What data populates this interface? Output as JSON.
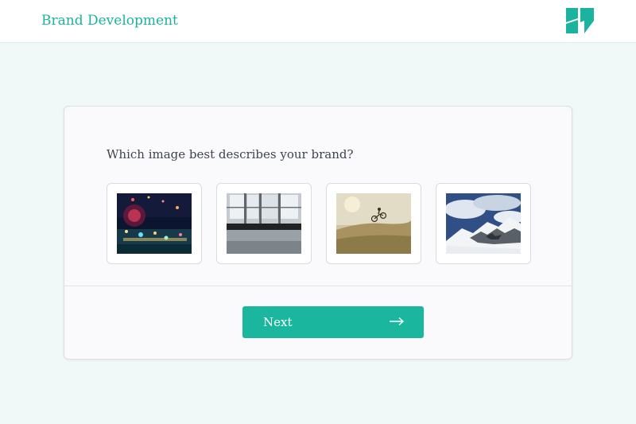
{
  "header": {
    "title": "Brand Development",
    "logo_icon": "brand-logo-icon",
    "accent_color": "#19b39e"
  },
  "survey": {
    "question": "Which image best describes your brand?",
    "options": [
      {
        "icon": "festival-lights-photo"
      },
      {
        "icon": "interior-window-photo"
      },
      {
        "icon": "mountain-bike-photo"
      },
      {
        "icon": "snowy-mountain-photo"
      }
    ],
    "next_label": "Next",
    "next_icon": "arrow-right-icon",
    "button_color": "#1ab69e"
  }
}
